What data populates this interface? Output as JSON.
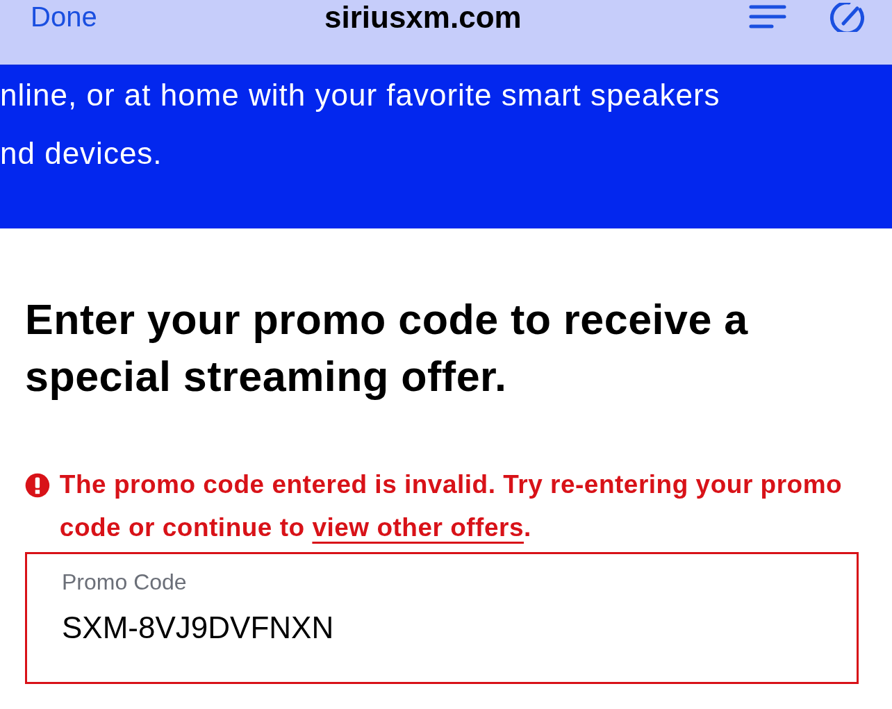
{
  "browser_bar": {
    "done_label": "Done",
    "address": "siriusxm.com"
  },
  "banner": {
    "lines": [
      "nline, or at home with your favorite smart speakers",
      "nd devices."
    ]
  },
  "heading": "Enter your promo code to receive a special streaming offer.",
  "error": {
    "text": "The promo code entered is invalid. Try re-entering your promo code or continue to ",
    "link": "view other offers",
    "end": "."
  },
  "promo_field": {
    "label": "Promo Code",
    "value": "SXM-8VJ9DVFNXN",
    "invalid": true
  }
}
